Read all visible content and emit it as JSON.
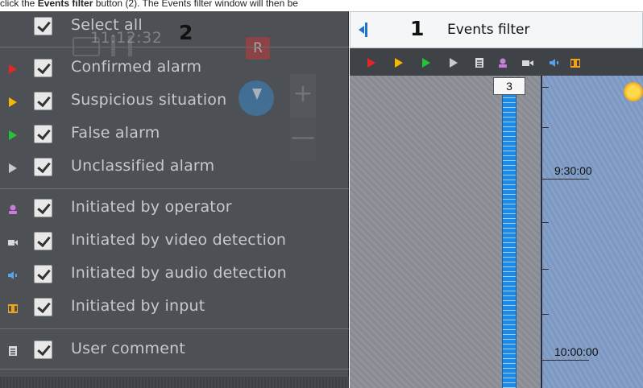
{
  "caption": {
    "prefix": "click the ",
    "bold": "Events filter",
    "suffix": " button (2). The Events filter window will then be"
  },
  "filter_menu": {
    "select_all": "Select all",
    "groups": [
      {
        "items": [
          {
            "label": "Confirmed alarm",
            "icon": "triangle-right-icon",
            "color": "#e32626",
            "checked": true
          },
          {
            "label": "Suspicious situation",
            "icon": "triangle-right-icon",
            "color": "#f5b800",
            "checked": true
          },
          {
            "label": "False alarm",
            "icon": "triangle-right-icon",
            "color": "#22c533",
            "checked": true
          },
          {
            "label": "Unclassified alarm",
            "icon": "triangle-right-icon",
            "color": "#c8c9cb",
            "checked": true
          }
        ]
      },
      {
        "items": [
          {
            "label": "Initiated by operator",
            "icon": "operator-icon",
            "color": "#c77ddb",
            "checked": true
          },
          {
            "label": "Initiated by video detection",
            "icon": "camera-icon",
            "color": "#d8d8d8",
            "checked": true
          },
          {
            "label": "Initiated by audio detection",
            "icon": "speaker-icon",
            "color": "#5aa2e8",
            "checked": true
          },
          {
            "label": "Initiated by input",
            "icon": "input-icon",
            "color": "#f2a21a",
            "checked": true
          }
        ]
      },
      {
        "items": [
          {
            "label": "User comment",
            "icon": "comment-icon",
            "color": "#d8d8d8",
            "checked": true
          }
        ]
      }
    ]
  },
  "background_controls": {
    "clock": "11:12:32",
    "record_badge": "R",
    "zoom_in": "+",
    "zoom_out": "—"
  },
  "callouts": {
    "one": "1",
    "two": "2"
  },
  "events_panel": {
    "title": "Events filter",
    "strip_icons": [
      "confirmed-alarm-icon",
      "suspicious-icon",
      "false-alarm-icon",
      "unclassified-icon",
      "comment-icon",
      "operator-icon",
      "camera-icon",
      "speaker-icon",
      "input-icon"
    ]
  },
  "timeline": {
    "event_count": "3",
    "time_labels": [
      "9:30:00",
      "10:00:00"
    ]
  }
}
